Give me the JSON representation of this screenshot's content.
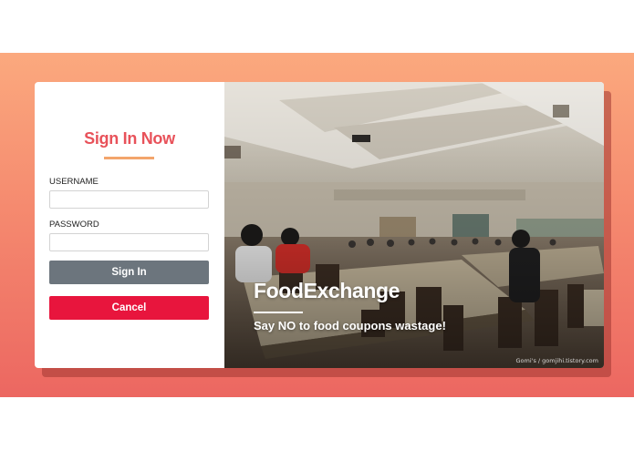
{
  "login": {
    "title": "Sign In Now",
    "username_label": "USERNAME",
    "username_value": "",
    "password_label": "PASSWORD",
    "password_value": "",
    "signin_label": "Sign In",
    "cancel_label": "Cancel"
  },
  "hero": {
    "brand": "FoodExchange",
    "tagline": "Say NO to food coupons wastage!",
    "watermark": "Gomi's / gomjihi.tistory.com"
  },
  "colors": {
    "accent_title": "#e8525a",
    "underline": "#f3a56c",
    "signin_button": "#6c757d",
    "cancel_button": "#e8153d",
    "background_top": "#fba97e",
    "background_bottom": "#ec6761"
  }
}
